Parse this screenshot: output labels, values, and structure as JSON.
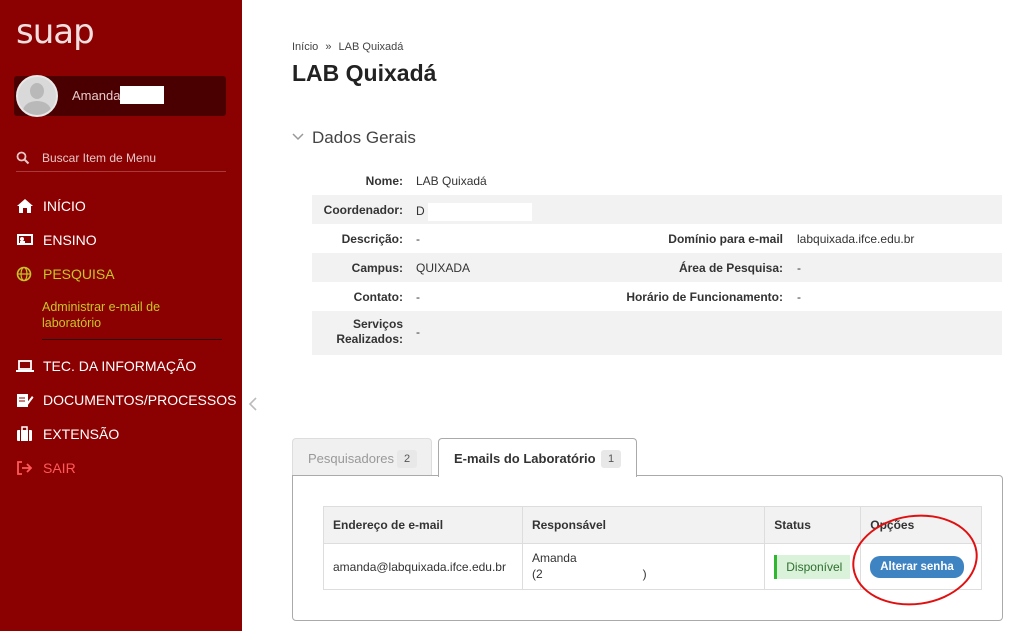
{
  "sidebar": {
    "logo": "suap",
    "user": {
      "name": "Amanda"
    },
    "search_placeholder": "Buscar Item de Menu",
    "items": [
      {
        "label": "INÍCIO",
        "icon": "home-icon"
      },
      {
        "label": "ENSINO",
        "icon": "chalkboard-icon"
      },
      {
        "label": "PESQUISA",
        "icon": "globe-icon"
      },
      {
        "label": "TEC. DA INFORMAÇÃO",
        "icon": "laptop-icon"
      },
      {
        "label": "DOCUMENTOS/PROCESSOS",
        "icon": "document-edit-icon"
      },
      {
        "label": "EXTENSÃO",
        "icon": "briefcase-icon"
      },
      {
        "label": "SAIR",
        "icon": "logout-icon"
      }
    ],
    "submenu": "Administrar e-mail de laboratório",
    "colors": {
      "bg": "#8b0000",
      "active": "#c6c62a",
      "logout": "#ff5a5a"
    }
  },
  "breadcrumb": {
    "home": "Início",
    "sep": "»",
    "current": "LAB Quixadá"
  },
  "page_title": "LAB Quixadá",
  "section": {
    "title": "Dados Gerais"
  },
  "info": {
    "nome": {
      "label": "Nome:",
      "value": "LAB Quixadá"
    },
    "coordenador": {
      "label": "Coordenador:",
      "value": "D"
    },
    "descricao": {
      "label": "Descrição:",
      "value": "-"
    },
    "dominio": {
      "label": "Domínio para e-mail",
      "value": "labquixada.ifce.edu.br"
    },
    "campus": {
      "label": "Campus:",
      "value": "QUIXADA"
    },
    "area": {
      "label": "Área de Pesquisa:",
      "value": "-"
    },
    "contato": {
      "label": "Contato:",
      "value": "-"
    },
    "horario": {
      "label": "Horário de Funcionamento:",
      "value": "-"
    },
    "servicos": {
      "label_line1": "Serviços",
      "label_line2": "Realizados:",
      "value": "-"
    }
  },
  "tabs": [
    {
      "label": "Pesquisadores",
      "count": "2"
    },
    {
      "label": "E-mails do Laboratório",
      "count": "1"
    }
  ],
  "emails_table": {
    "headers": [
      "Endereço de e-mail",
      "Responsável",
      "Status",
      "Opções"
    ],
    "rows": [
      {
        "email": "amanda@labquixada.ifce.edu.br",
        "responsavel_line1": "Amanda",
        "responsavel_line2_start": "(2",
        "responsavel_line2_end": ")",
        "status": "Disponível",
        "action": "Alterar senha"
      }
    ]
  }
}
